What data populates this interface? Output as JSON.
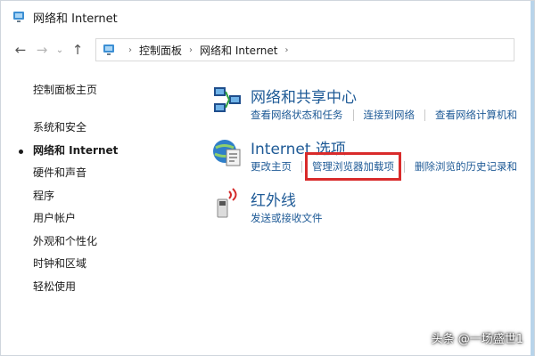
{
  "window": {
    "title": "网络和 Internet"
  },
  "navigation": {
    "back_icon": "arrow-left-icon",
    "forward_icon": "arrow-right-icon",
    "recent_icon": "chevron-down-icon",
    "up_icon": "arrow-up-icon",
    "breadcrumbs": [
      "控制面板",
      "网络和 Internet"
    ]
  },
  "sidebar": {
    "home_label": "控制面板主页",
    "items": [
      {
        "label": "系统和安全",
        "active": false
      },
      {
        "label": "网络和 Internet",
        "active": true
      },
      {
        "label": "硬件和声音",
        "active": false
      },
      {
        "label": "程序",
        "active": false
      },
      {
        "label": "用户帐户",
        "active": false
      },
      {
        "label": "外观和个性化",
        "active": false
      },
      {
        "label": "时钟和区域",
        "active": false
      },
      {
        "label": "轻松使用",
        "active": false
      }
    ]
  },
  "sections": [
    {
      "heading": "网络和共享中心",
      "icon": "network-sharing-center-icon",
      "links": [
        "查看网络状态和任务",
        "连接到网络",
        "查看网络计算机和"
      ]
    },
    {
      "heading": "Internet 选项",
      "icon": "internet-options-icon",
      "links": [
        "更改主页",
        "管理浏览器加载项",
        "删除浏览的历史记录和"
      ]
    },
    {
      "heading": "红外线",
      "icon": "infrared-icon",
      "links": [
        "发送或接收文件"
      ]
    }
  ],
  "highlight_color": "#d92b2b",
  "link_color": "#1e5a96",
  "watermark": "头条 @一场盛世1"
}
